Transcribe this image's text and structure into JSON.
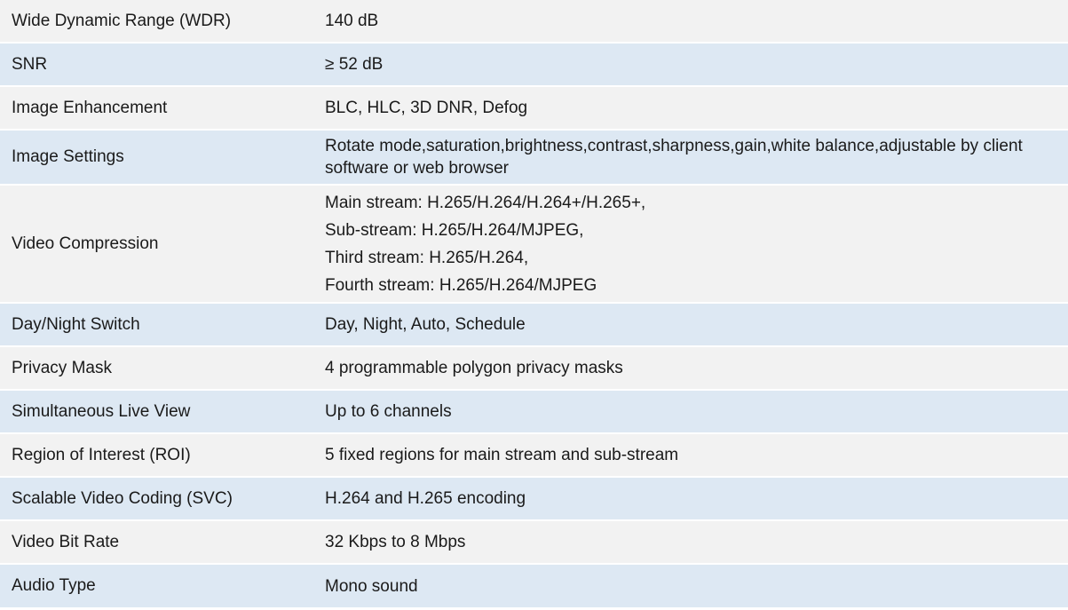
{
  "specs": [
    {
      "label": "Wide Dynamic Range (WDR)",
      "value": "140 dB"
    },
    {
      "label": "SNR",
      "value": "≥ 52 dB"
    },
    {
      "label": "Image Enhancement",
      "value": "BLC, HLC, 3D DNR, Defog"
    },
    {
      "label": "Image Settings",
      "value": "Rotate mode,saturation,brightness,contrast,sharpness,gain,white balance,adjustable by client software or web browser"
    },
    {
      "label": "Video Compression",
      "lines": [
        "Main stream: H.265/H.264/H.264+/H.265+,",
        "Sub-stream: H.265/H.264/MJPEG,",
        "Third stream: H.265/H.264,",
        "Fourth stream: H.265/H.264/MJPEG"
      ]
    },
    {
      "label": "Day/Night Switch",
      "value": "Day, Night, Auto, Schedule"
    },
    {
      "label": "Privacy Mask",
      "value": "4 programmable polygon privacy masks"
    },
    {
      "label": "Simultaneous Live View",
      "value": "Up to 6 channels"
    },
    {
      "label": "Region of Interest (ROI)",
      "value": "5 fixed regions for main stream and sub-stream"
    },
    {
      "label": "Scalable Video Coding (SVC)",
      "value": "H.264 and H.265 encoding"
    },
    {
      "label": "Video Bit Rate",
      "value": "32 Kbps to 8 Mbps"
    },
    {
      "label": "Audio Type",
      "value": "Mono sound"
    }
  ],
  "colors": {
    "row_odd": "#f2f2f2",
    "row_even": "#dde8f3",
    "text": "#1a1a1a"
  }
}
